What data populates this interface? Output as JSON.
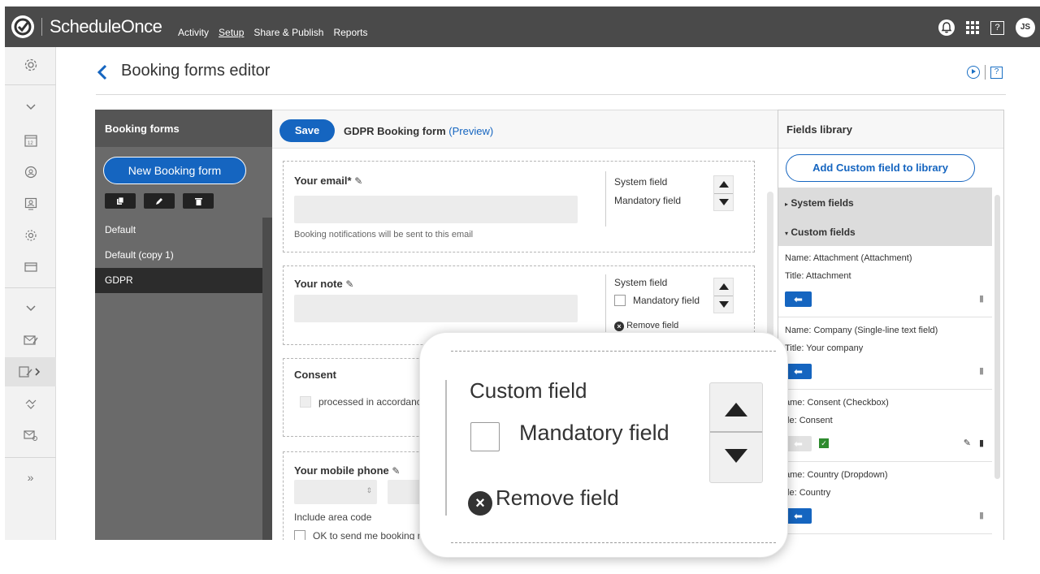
{
  "topbar": {
    "brand": "ScheduleOnce",
    "nav": [
      "Activity",
      "Setup",
      "Share & Publish",
      "Reports"
    ],
    "active_nav": "Setup",
    "avatar_initials": "JS",
    "help_glyph": "?"
  },
  "page": {
    "title": "Booking forms editor",
    "help_glyph": "?"
  },
  "booking_forms": {
    "heading": "Booking forms",
    "new_button": "New Booking form",
    "items": [
      "Default",
      "Default (copy 1)",
      "GDPR"
    ],
    "selected": "GDPR"
  },
  "editor": {
    "save_label": "Save",
    "form_name": "GDPR Booking form",
    "preview_label": "(Preview)",
    "fields": {
      "email": {
        "label": "Your email*",
        "hint": "Booking notifications will be sent to this email",
        "system": "System field",
        "mandatory": "Mandatory field"
      },
      "note": {
        "label": "Your note",
        "system": "System field",
        "mandatory": "Mandatory field",
        "remove": "Remove field"
      },
      "consent": {
        "label": "Consent",
        "text": "processed in accordance"
      },
      "phone": {
        "label": "Your mobile phone",
        "hint": "Include area code",
        "ok_text": "OK to send me booking no"
      }
    }
  },
  "library": {
    "heading": "Fields library",
    "add_button": "Add Custom field to library",
    "sections": [
      "System fields",
      "Custom fields"
    ],
    "items": [
      {
        "name": "Name: Attachment (Attachment)",
        "title": "Title: Attachment"
      },
      {
        "name": "Name: Company (Single-line text field)",
        "title": "Title: Your company"
      },
      {
        "name": "ame: Consent (Checkbox)",
        "title": "tle: Consent"
      },
      {
        "name": "ame: Country (Dropdown)",
        "title": "tle: Country"
      }
    ]
  },
  "zoom": {
    "custom_field": "Custom field",
    "mandatory": "Mandatory field",
    "remove": "Remove field"
  },
  "colors": {
    "accent": "#1565c0",
    "topbar": "#4a4a4a",
    "panel": "#6a6a6a"
  }
}
